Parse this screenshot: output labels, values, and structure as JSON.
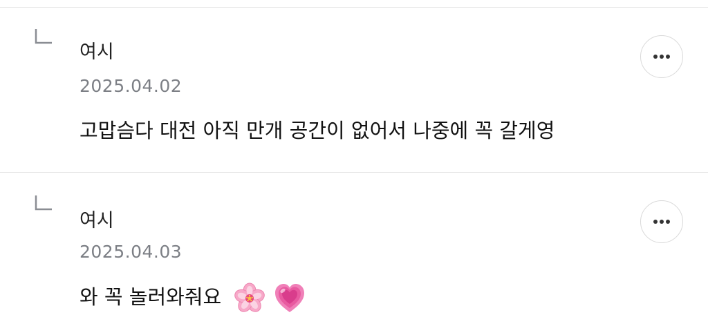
{
  "comments": [
    {
      "author": "여시",
      "date": "2025.04.02",
      "text": "고맙슴다 대전 아직 만개 공간이 없어서 나중에 꼭 갈게영",
      "emojis": []
    },
    {
      "author": "여시",
      "date": "2025.04.03",
      "text": "와 꼭 놀러와줘요",
      "emojis": [
        "cherry-blossom-icon",
        "growing-heart-icon"
      ]
    }
  ],
  "icons": {
    "reply": "reply-arrow-icon",
    "more": "more-options-icon"
  },
  "colors": {
    "divider": "#e3e3e3",
    "date": "#7c7f85",
    "reply_icon": "#8a8d93",
    "button_border": "#d9d9d9",
    "dots": "#333333"
  }
}
